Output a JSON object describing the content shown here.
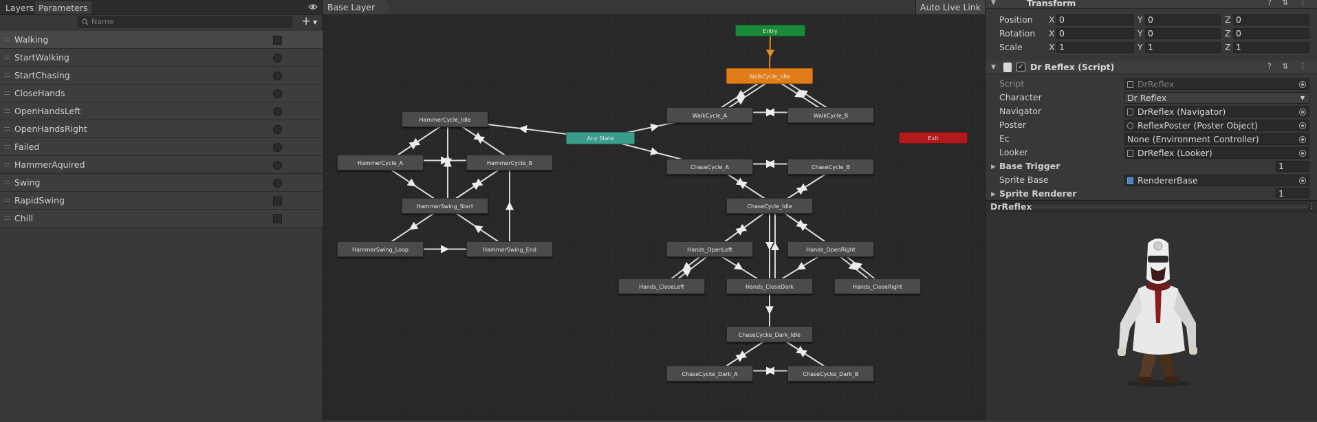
{
  "left_panel": {
    "tabs": [
      "Layers",
      "Parameters"
    ],
    "active_tab": "Parameters",
    "search_placeholder": "Name",
    "add_button": "+",
    "parameters": [
      {
        "name": "Walking",
        "type": "bool"
      },
      {
        "name": "StartWalking",
        "type": "trigger"
      },
      {
        "name": "StartChasing",
        "type": "trigger"
      },
      {
        "name": "CloseHands",
        "type": "trigger"
      },
      {
        "name": "OpenHandsLeft",
        "type": "trigger"
      },
      {
        "name": "OpenHandsRight",
        "type": "trigger"
      },
      {
        "name": "Failed",
        "type": "trigger"
      },
      {
        "name": "HammerAquired",
        "type": "trigger"
      },
      {
        "name": "Swing",
        "type": "trigger"
      },
      {
        "name": "RapidSwing",
        "type": "bool"
      },
      {
        "name": "Chill",
        "type": "bool"
      }
    ]
  },
  "graph": {
    "breadcrumb": "Base Layer",
    "auto_live_link": "Auto Live Link",
    "nodes": {
      "entry": "Entry",
      "walk_idle": "WalkCycle_Idle",
      "walk_a": "WalkCycle_A",
      "walk_b": "WalkCycle_B",
      "any_state": "Any State",
      "exit": "Exit",
      "hammer_idle": "HammerCycle_Idle",
      "hammer_a": "HammerCycle_A",
      "hammer_b": "HammerCycle_B",
      "swing_start": "HammerSwing_Start",
      "swing_loop": "HammerSwing_Loop",
      "swing_end": "HammerSwing_End",
      "chase_a": "ChaseCycle_A",
      "chase_b": "ChaseCycle_B",
      "chase_idle": "ChaseCycle_Idle",
      "open_left": "Hands_OpenLeft",
      "open_right": "Hands_OpenRight",
      "close_left": "Hands_CloseLeft",
      "close_dark": "Hands_CloseDark",
      "close_right": "Hands_CloseRight",
      "dark_idle": "ChaseCycke_Dark_Idle",
      "dark_a": "ChaseCycke_Dark_A",
      "dark_b": "ChaseCycke_Dark_B"
    }
  },
  "inspector": {
    "transform": {
      "title": "Transform",
      "rows": [
        {
          "label": "Position",
          "x": "0",
          "y": "0",
          "z": "0"
        },
        {
          "label": "Rotation",
          "x": "0",
          "y": "0",
          "z": "0"
        },
        {
          "label": "Scale",
          "x": "1",
          "y": "1",
          "z": "1"
        }
      ]
    },
    "script": {
      "title": "Dr Reflex (Script)",
      "script_label": "Script",
      "script_value": "DrReflex",
      "character_label": "Character",
      "character_value": "Dr Reflex",
      "navigator_label": "Navigator",
      "navigator_value": "DrReflex (Navigator)",
      "poster_label": "Poster",
      "poster_value": "ReflexPoster (Poster Object)",
      "ec_label": "Ec",
      "ec_value": "None (Environment Controller)",
      "looker_label": "Looker",
      "looker_value": "DrReflex (Looker)",
      "base_trigger_label": "Base Trigger",
      "base_trigger_value": "1",
      "sprite_base_label": "Sprite Base",
      "sprite_base_value": "RendererBase",
      "sprite_renderer_label": "Sprite Renderer",
      "sprite_renderer_value": "1"
    },
    "preview_title": "DrReflex"
  }
}
